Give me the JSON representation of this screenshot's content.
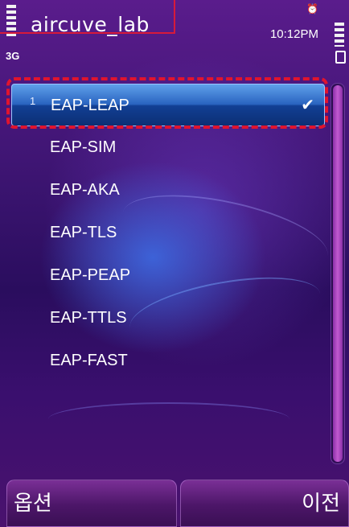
{
  "status_bar": {
    "app_title": "aircuve_lab",
    "network": "3G",
    "time": "10:12PM",
    "alarm_icon": "alarm-clock-icon",
    "signal_icon": "signal-strength-icon",
    "battery_icon": "battery-icon"
  },
  "list": {
    "items": [
      {
        "label": "EAP-LEAP",
        "shortcut": "1",
        "selected": true,
        "check": "✔"
      },
      {
        "label": "EAP-SIM"
      },
      {
        "label": "EAP-AKA"
      },
      {
        "label": "EAP-TLS"
      },
      {
        "label": "EAP-PEAP"
      },
      {
        "label": "EAP-TTLS"
      },
      {
        "label": "EAP-FAST"
      }
    ]
  },
  "softkeys": {
    "left": "옵션",
    "right": "이전"
  },
  "colors": {
    "highlight": "#2a64c0",
    "annotation_red": "#e0142e",
    "background": "#3b1470"
  }
}
